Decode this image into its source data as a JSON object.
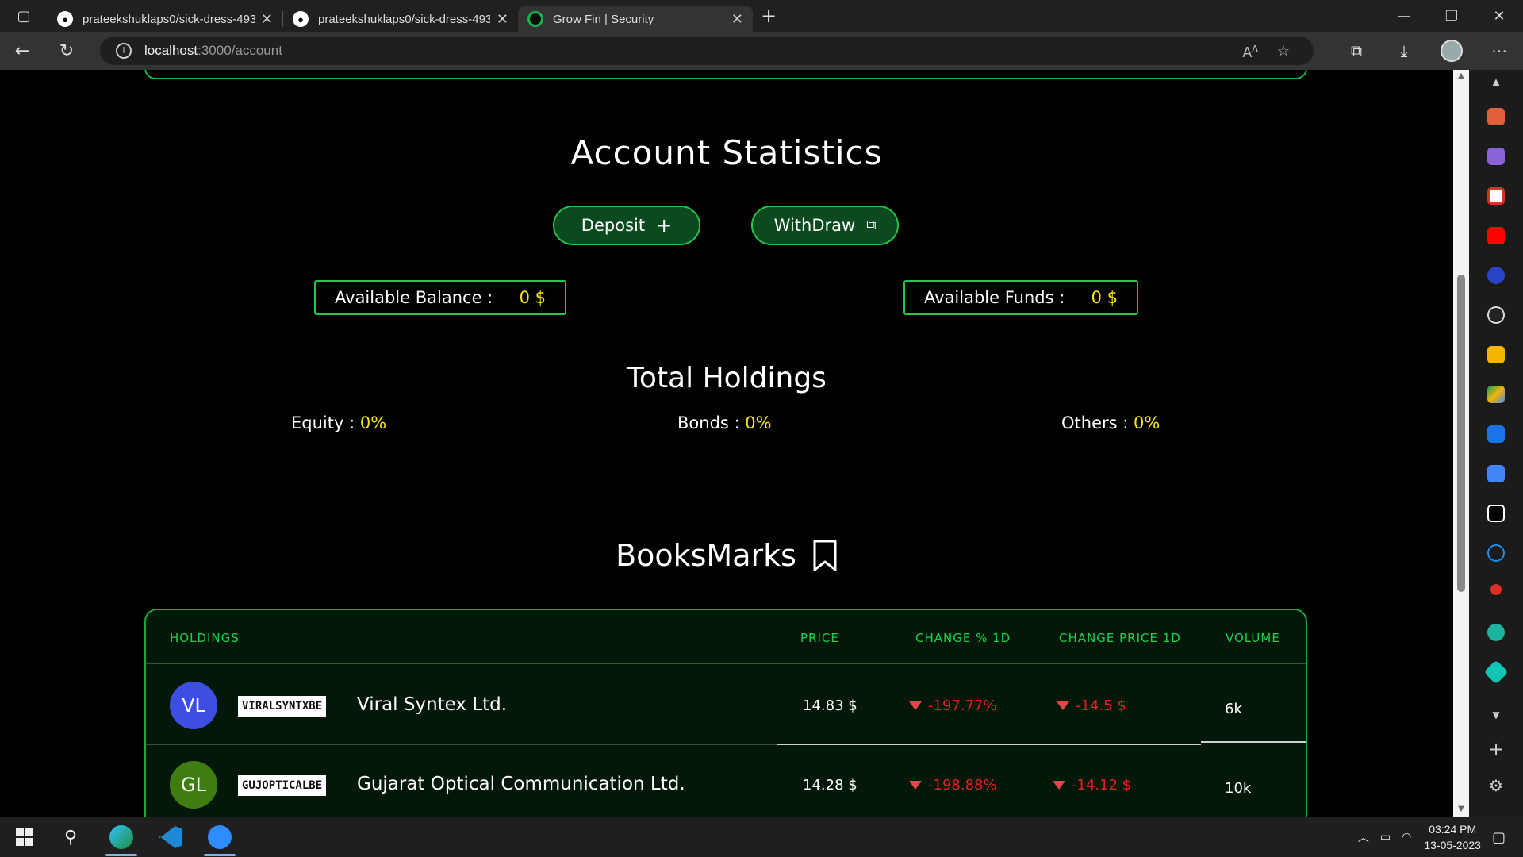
{
  "browser": {
    "tabs": [
      {
        "label": "prateekshuklaps0/sick-dress-493",
        "icon": "github-icon",
        "active": false
      },
      {
        "label": "prateekshuklaps0/sick-dress-493",
        "icon": "github-icon",
        "active": false
      },
      {
        "label": "Grow Fin | Security",
        "icon": "growfin-icon",
        "active": true
      }
    ],
    "url_host": "localhost",
    "url_path": ":3000/account"
  },
  "page": {
    "stats_title": "Account Statistics",
    "deposit_label": "Deposit",
    "withdraw_label": "WithDraw",
    "available_balance_label": "Available Balance :",
    "available_balance_value": "0 $",
    "available_funds_label": "Available Funds :",
    "available_funds_value": "0 $",
    "holdings_title": "Total Holdings",
    "holdings": [
      {
        "label": "Equity : ",
        "value": "0%"
      },
      {
        "label": "Bonds : ",
        "value": "0%"
      },
      {
        "label": "Others : ",
        "value": "0%"
      }
    ],
    "bookmarks_title": "BooksMarks"
  },
  "table": {
    "headers": [
      "HOLDINGS",
      "PRICE",
      "CHANGE % 1D",
      "CHANGE PRICE 1D",
      "VOLUME"
    ],
    "rows": [
      {
        "initials": "VL",
        "avatar_color": "#3d4ee3",
        "ticker": "VIRALSYNTXBE",
        "name": "Viral Syntex Ltd.",
        "price": "14.83 $",
        "change_pct": "-197.77%",
        "change_price": "-14.5 $",
        "volume": "6k"
      },
      {
        "initials": "GL",
        "avatar_color": "#3f7d12",
        "ticker": "GUJOPTICALBE",
        "name": "Gujarat Optical Communication Ltd.",
        "price": "14.28 $",
        "change_pct": "-198.88%",
        "change_price": "-14.12 $",
        "volume": "10k"
      }
    ]
  },
  "taskbar": {
    "time": "03:24 PM",
    "date": "13-05-2023"
  },
  "colors": {
    "accent_green": "#22c44a",
    "value_yellow": "#f5e50a",
    "negative_red": "#e32020"
  }
}
